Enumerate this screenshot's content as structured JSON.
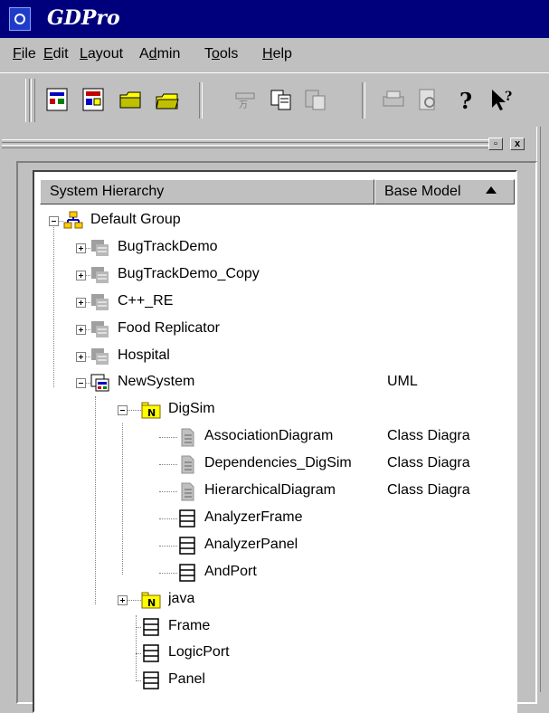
{
  "app": {
    "title": "GDPro"
  },
  "menu": [
    {
      "pre": "",
      "u": "F",
      "post": "ile",
      "name": "menu-file"
    },
    {
      "pre": "",
      "u": "E",
      "post": "dit",
      "name": "menu-edit"
    },
    {
      "pre": "",
      "u": "L",
      "post": "ayout",
      "name": "menu-layout"
    },
    {
      "pre": "A",
      "u": "d",
      "post": "min",
      "name": "menu-admin"
    },
    {
      "pre": "T",
      "u": "o",
      "post": "ols",
      "name": "menu-tools"
    },
    {
      "pre": "",
      "u": "H",
      "post": "elp",
      "name": "menu-help"
    }
  ],
  "toolbar": {
    "buttons": [
      "new-icon",
      "open-repo-icon",
      "open-folder-icon",
      "save-icon",
      "cut-icon",
      "copy-icon",
      "paste-icon",
      "print-icon",
      "print-preview-icon",
      "help-icon",
      "context-help-icon"
    ]
  },
  "panel": {
    "close_label": "x",
    "min_label": "▫"
  },
  "columns": {
    "hierarchy": "System Hierarchy",
    "model": "Base Model"
  },
  "tree": [
    {
      "label": "Default Group",
      "model": "",
      "icon": "group-icon",
      "level": 0,
      "expander": "minus"
    },
    {
      "label": "BugTrackDemo",
      "model": "",
      "icon": "system-disabled-icon",
      "level": 1,
      "expander": "plus"
    },
    {
      "label": "BugTrackDemo_Copy",
      "model": "",
      "icon": "system-disabled-icon",
      "level": 1,
      "expander": "plus"
    },
    {
      "label": "C++_RE",
      "model": "",
      "icon": "system-disabled-icon",
      "level": 1,
      "expander": "plus"
    },
    {
      "label": "Food Replicator",
      "model": "",
      "icon": "system-disabled-icon",
      "level": 1,
      "expander": "plus"
    },
    {
      "label": "Hospital",
      "model": "",
      "icon": "system-disabled-icon",
      "level": 1,
      "expander": "plus"
    },
    {
      "label": "NewSystem",
      "model": "UML",
      "icon": "system-icon",
      "level": 1,
      "expander": "minus"
    },
    {
      "label": "DigSim",
      "model": "",
      "icon": "package-icon",
      "level": 2,
      "expander": "minus"
    },
    {
      "label": "AssociationDiagram",
      "model": "Class Diagra",
      "icon": "diagram-icon",
      "level": 3,
      "expander": ""
    },
    {
      "label": "Dependencies_DigSim",
      "model": "Class Diagra",
      "icon": "diagram-icon",
      "level": 3,
      "expander": ""
    },
    {
      "label": "HierarchicalDiagram",
      "model": "Class Diagra",
      "icon": "diagram-icon",
      "level": 3,
      "expander": ""
    },
    {
      "label": "AnalyzerFrame",
      "model": "",
      "icon": "class-icon",
      "level": 3,
      "expander": ""
    },
    {
      "label": "AnalyzerPanel",
      "model": "",
      "icon": "class-icon",
      "level": 3,
      "expander": ""
    },
    {
      "label": "AndPort",
      "model": "",
      "icon": "class-icon",
      "level": 3,
      "expander": ""
    },
    {
      "label": "java",
      "model": "",
      "icon": "package-icon",
      "level": 2,
      "expander": "plus"
    },
    {
      "label": "Frame",
      "model": "",
      "icon": "class-icon",
      "level": 2,
      "expander": ""
    },
    {
      "label": "LogicPort",
      "model": "",
      "icon": "class-icon",
      "level": 2,
      "expander": ""
    },
    {
      "label": "Panel",
      "model": "",
      "icon": "class-icon",
      "level": 2,
      "expander": ""
    }
  ]
}
